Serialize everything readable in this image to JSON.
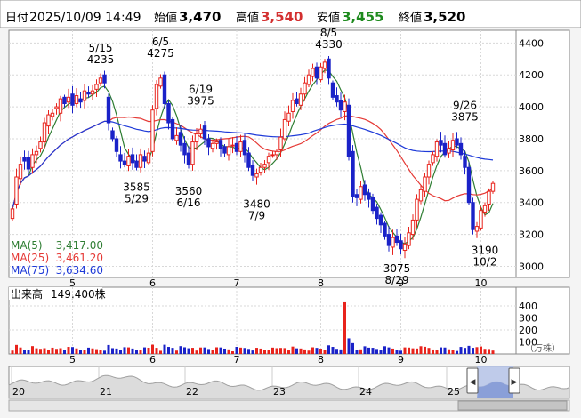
{
  "header": {
    "date_label": "日付",
    "datetime": "2025/10/09 14:49",
    "open_label": "始値",
    "open_value": "3,470",
    "high_label": "高値",
    "high_value": "3,540",
    "low_label": "安値",
    "low_value": "3,455",
    "close_label": "終値",
    "close_value": "3,520"
  },
  "colors": {
    "up": "#e8231c",
    "down": "#1a22c8",
    "ma5": "#2e7d32",
    "ma25": "#e53935",
    "ma75": "#1e3ad8",
    "low_value": "#1d8a1d",
    "high_value": "#d32f2f",
    "navigator_fill": "#b4c2e6"
  },
  "legend": [
    {
      "label": "MA(5)",
      "value": "3,417.00",
      "color": "#2e7d32"
    },
    {
      "label": "MA(25)",
      "value": "3,461.20",
      "color": "#e53935"
    },
    {
      "label": "MA(75)",
      "value": "3,634.60",
      "color": "#1e3ad8"
    }
  ],
  "volume": {
    "label": "出来高",
    "value": "149,400株",
    "unit": "（万株）",
    "ticks": [
      "400",
      "300",
      "200",
      "100"
    ]
  },
  "navigator": {
    "labels": [
      "20",
      "21",
      "22",
      "23",
      "24",
      "25"
    ],
    "left_arrow": "◀",
    "right_arrow": "▶"
  },
  "chart_data": {
    "type": "candlestick",
    "y_ticks": [
      "4400",
      "4200",
      "4000",
      "3800",
      "3600",
      "3400",
      "3200",
      "3000"
    ],
    "ylim": [
      2930,
      4480
    ],
    "x_months": [
      {
        "label": "5",
        "index": 15
      },
      {
        "label": "6",
        "index": 35
      },
      {
        "label": "7",
        "index": 56
      },
      {
        "label": "8",
        "index": 77
      },
      {
        "label": "9",
        "index": 97
      },
      {
        "label": "10",
        "index": 117
      }
    ],
    "annotations": [
      {
        "date": "5/15",
        "price": "4235",
        "index": 22,
        "pos": "above"
      },
      {
        "date": "6/5",
        "price": "4275",
        "index": 37,
        "pos": "above"
      },
      {
        "date": "6/19",
        "price": "3975",
        "index": 47,
        "pos": "above"
      },
      {
        "date": "8/5",
        "price": "4330",
        "index": 79,
        "pos": "above"
      },
      {
        "date": "9/26",
        "price": "3875",
        "index": 113,
        "pos": "above"
      },
      {
        "date": "5/29",
        "price": "3585",
        "index": 31,
        "pos": "below"
      },
      {
        "date": "6/16",
        "price": "3560",
        "index": 44,
        "pos": "below"
      },
      {
        "date": "7/9",
        "price": "3480",
        "index": 61,
        "pos": "below"
      },
      {
        "date": "8/29",
        "price": "3075",
        "index": 96,
        "pos": "below"
      },
      {
        "date": "10/2",
        "price": "3190",
        "index": 118,
        "pos": "below"
      }
    ],
    "closes": [
      3360,
      3560,
      3640,
      3660,
      3610,
      3700,
      3720,
      3780,
      3900,
      3950,
      3960,
      4000,
      4050,
      4020,
      4060,
      4010,
      4070,
      4030,
      4100,
      4080,
      4100,
      4140,
      4180,
      4150,
      3900,
      3800,
      3720,
      3660,
      3640,
      3690,
      3650,
      3620,
      3700,
      3660,
      3710,
      3980,
      4140,
      4180,
      4020,
      3900,
      3800,
      3820,
      3760,
      3700,
      3640,
      3780,
      3830,
      3860,
      3800,
      3750,
      3770,
      3780,
      3740,
      3710,
      3750,
      3760,
      3720,
      3780,
      3700,
      3620,
      3570,
      3580,
      3620,
      3640,
      3690,
      3700,
      3720,
      3810,
      3920,
      3960,
      4040,
      4020,
      4080,
      4150,
      4200,
      4240,
      4180,
      4250,
      4280,
      4180,
      4060,
      4030,
      3980,
      4030,
      3690,
      3440,
      3430,
      3500,
      3450,
      3420,
      3350,
      3300,
      3260,
      3190,
      3130,
      3180,
      3150,
      3110,
      3140,
      3210,
      3290,
      3420,
      3480,
      3560,
      3640,
      3700,
      3780,
      3760,
      3700,
      3740,
      3790,
      3760,
      3700,
      3620,
      3400,
      3230,
      3250,
      3350,
      3380,
      3470,
      3520
    ],
    "opens": [
      3300,
      3390,
      3550,
      3680,
      3680,
      3620,
      3700,
      3740,
      3780,
      3880,
      3940,
      3990,
      3960,
      4060,
      4030,
      4080,
      4020,
      4050,
      4040,
      4090,
      4080,
      4110,
      4150,
      4200,
      4060,
      3850,
      3800,
      3700,
      3660,
      3630,
      3700,
      3660,
      3620,
      3690,
      3650,
      3720,
      3990,
      4130,
      4200,
      4020,
      3920,
      3790,
      3840,
      3770,
      3710,
      3640,
      3780,
      3830,
      3880,
      3800,
      3740,
      3770,
      3790,
      3750,
      3700,
      3760,
      3770,
      3720,
      3790,
      3710,
      3630,
      3560,
      3590,
      3620,
      3650,
      3700,
      3700,
      3730,
      3800,
      3910,
      3970,
      4050,
      4010,
      4080,
      4140,
      4190,
      4250,
      4170,
      4240,
      4300,
      4150,
      4070,
      4040,
      3970,
      4010,
      3720,
      3450,
      3420,
      3510,
      3460,
      3430,
      3370,
      3320,
      3270,
      3200,
      3120,
      3190,
      3160,
      3100,
      3130,
      3200,
      3290,
      3410,
      3470,
      3560,
      3650,
      3690,
      3790,
      3770,
      3710,
      3730,
      3800,
      3770,
      3690,
      3620,
      3400,
      3220,
      3240,
      3340,
      3390,
      3470
    ]
  }
}
